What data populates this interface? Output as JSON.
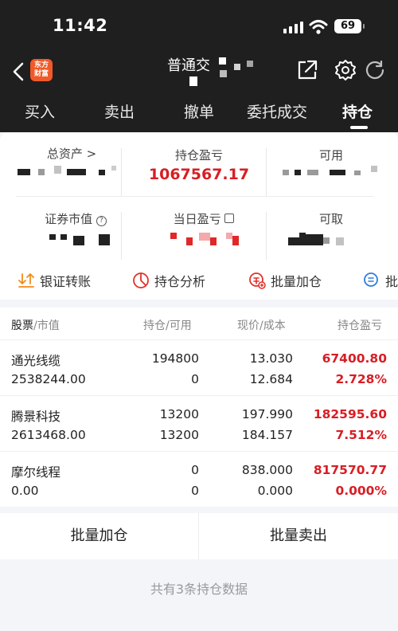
{
  "status_bar": {
    "time": "11:42",
    "battery": "69"
  },
  "nav": {
    "logo": "东方财富",
    "title": "普通交"
  },
  "tabs": [
    {
      "label": "买入"
    },
    {
      "label": "卖出"
    },
    {
      "label": "撤单"
    },
    {
      "label": "委托成交"
    },
    {
      "label": "持仓"
    }
  ],
  "summary": {
    "total_assets_label": "总资产 >",
    "position_pnl_label": "持仓盈亏",
    "position_pnl_value": "1067567.17",
    "available_label": "可用",
    "market_value_label": "证券市值",
    "daily_pnl_label": "当日盈亏",
    "withdrawable_label": "可取"
  },
  "actions": [
    {
      "label": "银证转账"
    },
    {
      "label": "持仓分析"
    },
    {
      "label": "批量加仓"
    },
    {
      "label": "批量"
    }
  ],
  "table": {
    "headers": {
      "stock": "股票",
      "market_value": "/市值",
      "position": "持仓/可用",
      "price": "现价/成本",
      "pnl": "持仓盈亏"
    },
    "rows": [
      {
        "name": "通光线缆",
        "value": "2538244.00",
        "qty": "194800",
        "avail": "0",
        "price": "13.030",
        "cost": "12.684",
        "pnl": "67400.80",
        "pct": "2.728%"
      },
      {
        "name": "腾景科技",
        "value": "2613468.00",
        "qty": "13200",
        "avail": "13200",
        "price": "197.990",
        "cost": "184.157",
        "pnl": "182595.60",
        "pct": "7.512%"
      },
      {
        "name": "摩尔线程",
        "value": "0.00",
        "qty": "0",
        "avail": "0",
        "price": "838.000",
        "cost": "0.000",
        "pnl": "817570.77",
        "pct": "0.000%"
      }
    ]
  },
  "buttons": {
    "batch_add": "批量加仓",
    "batch_sell": "批量卖出"
  },
  "footer": "共有3条持仓数据",
  "colors": {
    "header_bg": "#1f1f1f",
    "accent_red": "#d81e24",
    "logo_orange": "#f05a28"
  }
}
